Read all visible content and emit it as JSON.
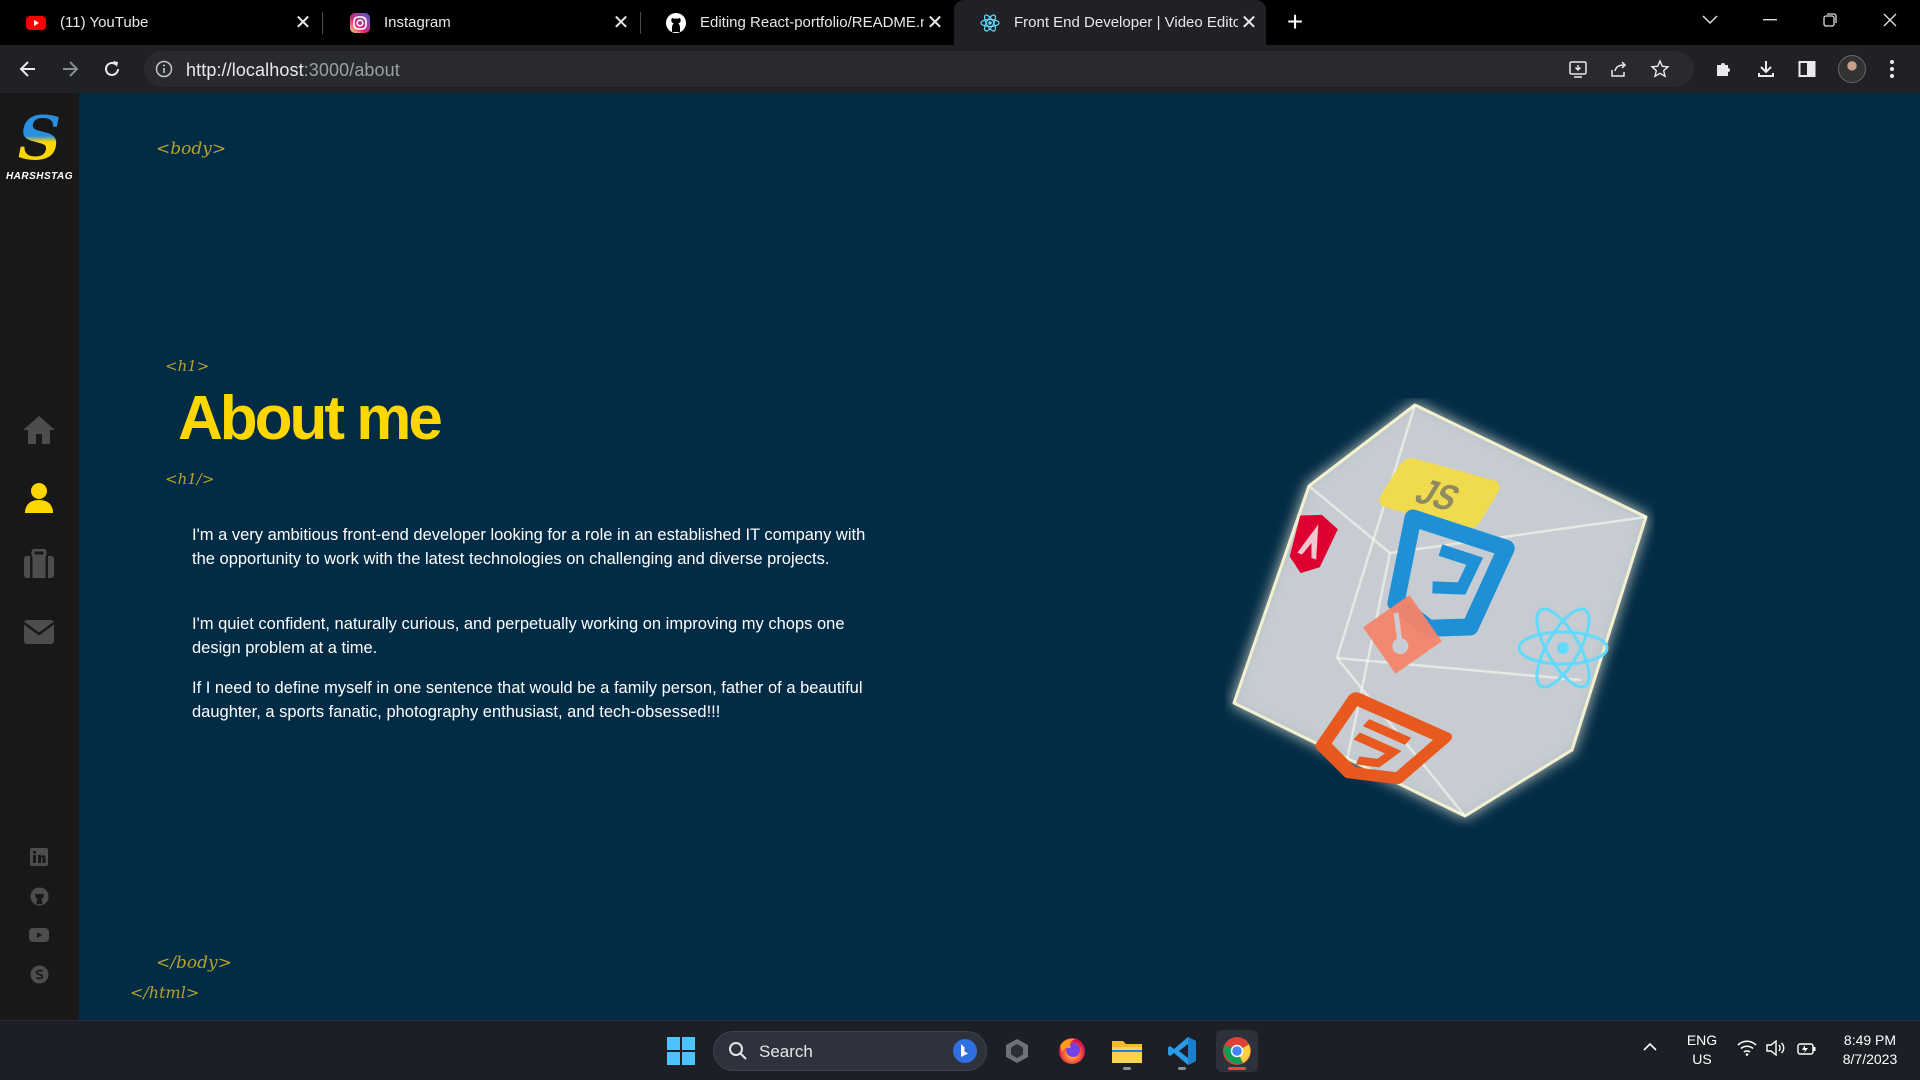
{
  "browser": {
    "tabs": [
      {
        "title": "(11) YouTube",
        "icon": "youtube-icon"
      },
      {
        "title": "Instagram",
        "icon": "instagram-icon"
      },
      {
        "title": "Editing React-portfolio/README.md",
        "icon": "github-icon"
      },
      {
        "title": "Front End Developer | Video Editor |",
        "icon": "react-icon",
        "active": true
      }
    ],
    "url_host": "http://localhost",
    "url_rest": ":3000/about"
  },
  "sidebar": {
    "logo_letter": "S",
    "logo_name": "HARSHSTAG",
    "nav": [
      "home-icon",
      "user-icon",
      "briefcase-icon",
      "envelope-icon"
    ],
    "active_nav": "user-icon",
    "social": [
      "linkedin-icon",
      "github-icon",
      "youtube-icon",
      "skype-icon"
    ]
  },
  "page": {
    "tag_body_open": "<body>",
    "tag_h1_open": "<h1>",
    "heading": "About me",
    "tag_h1_close": "<h1/>",
    "paragraphs": [
      "I'm a very ambitious front-end developer looking for a role in an established IT company with the opportunity to work with the latest technologies on challenging and diverse projects.",
      "I'm quiet confident, naturally curious, and perpetually working on improving my chops one design problem at a time.",
      "If I need to define myself in one sentence that would be a family person, father of a beautiful daughter, a sports fanatic, photography enthusiast, and tech-obsessed!!!"
    ],
    "tag_body_close": "</body>",
    "tag_html_close": "</html>",
    "accent_color": "#ffd700",
    "background_color": "#022b45",
    "cube_faces": [
      "angular-icon",
      "js-icon",
      "css3-icon",
      "react-icon",
      "git-icon",
      "html5-icon"
    ]
  },
  "taskbar": {
    "search_label": "Search",
    "apps": [
      "windows-start-icon",
      "bing-icon",
      "app-icon",
      "firefox-icon",
      "file-explorer-icon",
      "vscode-icon",
      "chrome-icon"
    ],
    "lang_line1": "ENG",
    "lang_line2": "US",
    "time": "8:49 PM",
    "date": "8/7/2023"
  }
}
